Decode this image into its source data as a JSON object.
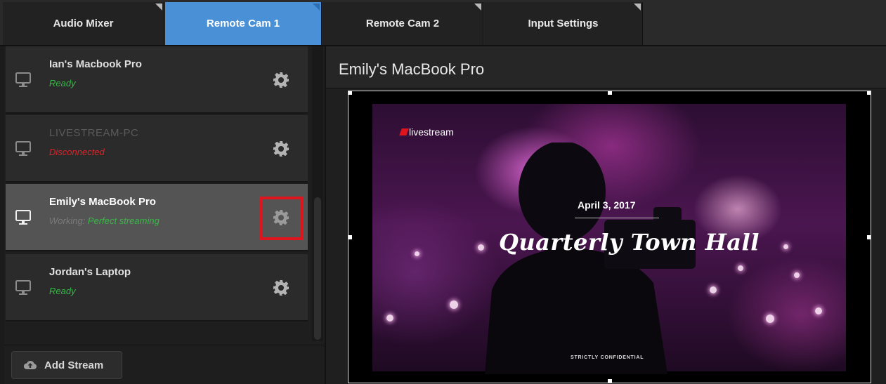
{
  "tabs": [
    {
      "label": "Audio Mixer"
    },
    {
      "label": "Remote Cam 1"
    },
    {
      "label": "Remote Cam 2"
    },
    {
      "label": "Input Settings"
    }
  ],
  "streams": [
    {
      "name": "Ian's Macbook Pro",
      "status": "Ready"
    },
    {
      "name": "LIVESTREAM-PC",
      "status": "Disconnected"
    },
    {
      "name": "Emily's MacBook Pro",
      "status_label": "Working:",
      "status_detail": "Perfect streaming"
    },
    {
      "name": "Jordan's Laptop",
      "status": "Ready"
    }
  ],
  "add_stream_label": "Add Stream",
  "preview": {
    "title": "Emily's MacBook Pro",
    "logo_text": "livestream",
    "date": "April 3, 2017",
    "event_title": "Quarterly Town Hall",
    "footer": "STRICTLY CONFIDENTIAL"
  },
  "colors": {
    "active_tab": "#4a90d6",
    "ready": "#3bb54a",
    "disconnected": "#d8262b",
    "highlight": "#e0141d"
  },
  "icons": [
    "monitor-icon",
    "gear-icon",
    "cloud-upload-icon"
  ]
}
